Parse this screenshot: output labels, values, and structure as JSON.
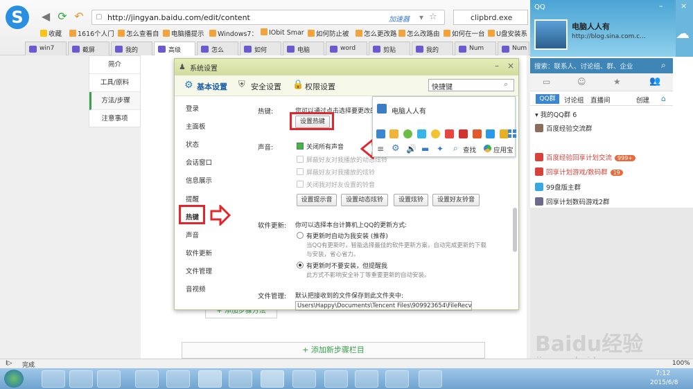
{
  "browser": {
    "url": "http://jingyan.baidu.com/edit/content",
    "accelerator": "加速器",
    "search_text": "clipbrd.exe",
    "bookmarks": [
      "收藏",
      "1616个人门",
      "怎么查看自",
      "电脑播提示",
      "Windows7：",
      "IObit Smar",
      "如何防止被",
      "怎么更改路",
      "怎么改路由",
      "如何在一台",
      "U盘安装系"
    ],
    "tabs": [
      "win7",
      "截屏",
      "我的",
      "高级",
      "怎么",
      "如何",
      "电脑",
      "word",
      "剪贴",
      "我的",
      "Num",
      "Num"
    ]
  },
  "article_nav": [
    "简介",
    "工具/原料",
    "方法/步骤",
    "注意事项"
  ],
  "page": {
    "add_method": "+ 添加步骤方法",
    "add_step": "+ 添加新步骤栏目"
  },
  "dialog": {
    "title": "系统设置",
    "tabs": [
      "基本设置",
      "安全设置",
      "权限设置"
    ],
    "search": "快捷键",
    "nav": [
      "登录",
      "主面板",
      "状态",
      "会话窗口",
      "信息展示",
      "提醒",
      "热键",
      "声音",
      "软件更新",
      "文件管理",
      "音视频"
    ],
    "hotkey_label": "热键:",
    "hotkey_desc": "您可以通过点击选择要更改的",
    "hotkey_button": "设置热键",
    "sound_label": "声音:",
    "sound_options": [
      "关闭所有声音",
      "屏蔽好友对我播放的动态炫铃",
      "屏蔽好友对我播放的炫铃",
      "关闭我对好友设置的铃音"
    ],
    "sound_buttons": [
      "设置提示音",
      "设置动态炫铃",
      "设置炫铃",
      "设置好友铃音"
    ],
    "update_label": "软件更新:",
    "update_desc": "你可以选择本台计算机上QQ的更新方式:",
    "update_opt1": "有更新时自动为我安装 (推荐)",
    "update_opt1_desc1": "当QQ有更新时，智能选择最佳的软件更新方案，自动完成更新的下载",
    "update_opt1_desc2": "与安装，省心省力。",
    "update_opt2": "有更新时不要安装，但提醒我",
    "update_opt2_desc": "此方式不影响安全补丁等重要更新的自动安装。",
    "file_label": "文件管理:",
    "file_desc": "默认把接收到的文件保存到此文件夹中:",
    "file_path": "Users\\Happy\\Documents\\Tencent Files\\909923654\\FileRecv\\"
  },
  "popup": {
    "title": "电脑人人有",
    "find": "查找",
    "app": "应用宝"
  },
  "qq": {
    "label": "QQ",
    "nickname": "电脑人人有",
    "signature": "http://blog.sina.com.c...",
    "search": "搜索：联系人、讨论组、群、企业",
    "tabs": [
      "QQ群",
      "讨论组",
      "直播间"
    ],
    "create": "创建",
    "my_groups": "我的QQ群",
    "my_groups_count": "6",
    "groups": [
      {
        "name": "百度经验交流群",
        "badge": ""
      },
      {
        "name": "百度经验回享计划交流",
        "badge": "999+"
      },
      {
        "name": "回享计划游戏/数码群",
        "badge": "19"
      },
      {
        "name": "99盘版主群",
        "badge": ""
      },
      {
        "name": "回享计划数码游戏2群",
        "badge": ""
      }
    ]
  },
  "status": {
    "text": "完成",
    "zoom": "100%"
  },
  "clock": {
    "time": "7:12",
    "date": "2015/6/8"
  },
  "watermark": {
    "brand": "Baidu经验",
    "url": "jingyan.baidu.com"
  }
}
